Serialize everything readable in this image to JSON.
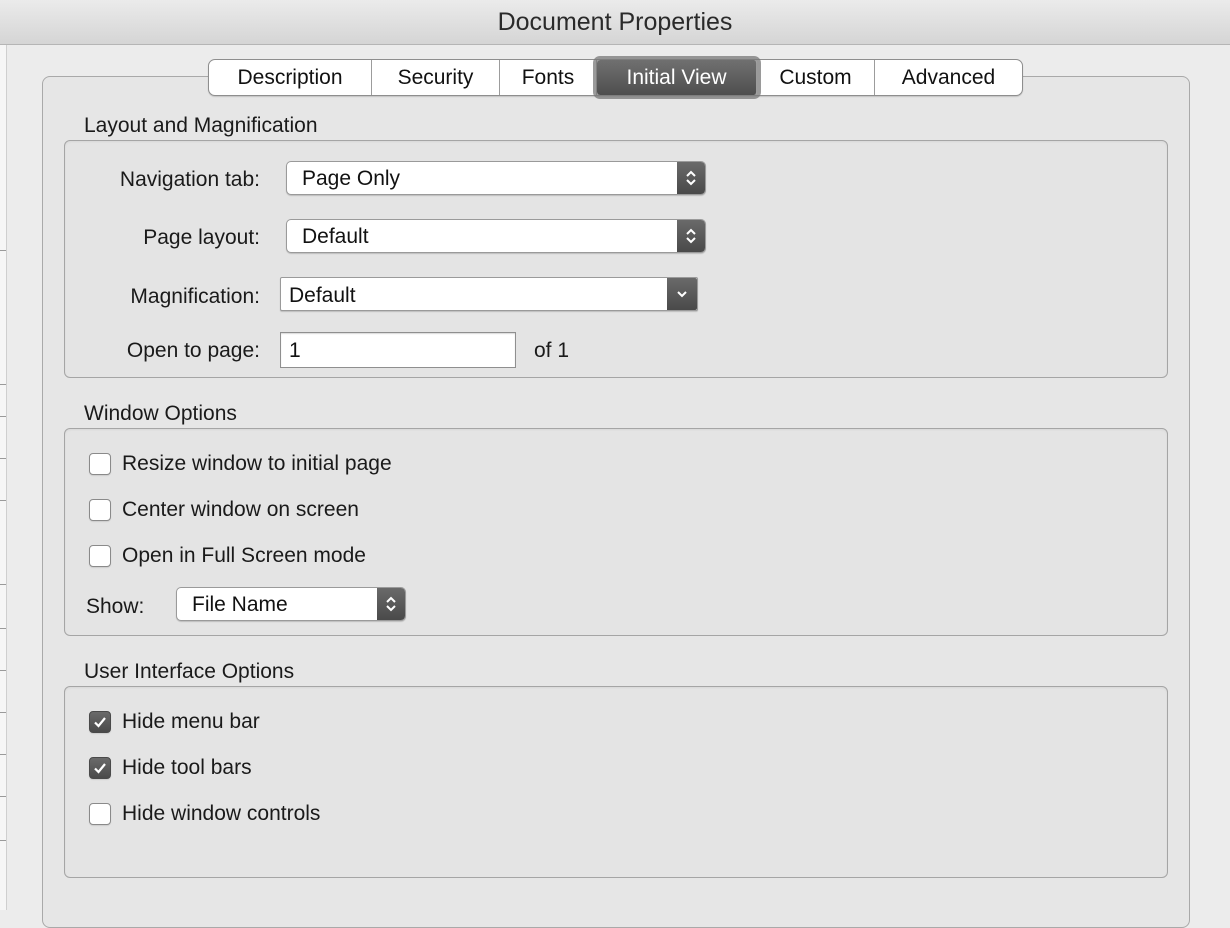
{
  "window": {
    "title": "Document Properties"
  },
  "tabs": [
    {
      "label": "Description",
      "active": false
    },
    {
      "label": "Security",
      "active": false
    },
    {
      "label": "Fonts",
      "active": false
    },
    {
      "label": "Initial View",
      "active": true
    },
    {
      "label": "Custom",
      "active": false
    },
    {
      "label": "Advanced",
      "active": false
    }
  ],
  "layout_magnification": {
    "heading": "Layout and Magnification",
    "navigation_tab": {
      "label": "Navigation tab:",
      "value": "Page Only"
    },
    "page_layout": {
      "label": "Page layout:",
      "value": "Default"
    },
    "magnification": {
      "label": "Magnification:",
      "value": "Default"
    },
    "open_to_page": {
      "label": "Open to page:",
      "value": "1",
      "of_text": "of 1"
    }
  },
  "window_options": {
    "heading": "Window Options",
    "resize": {
      "label": "Resize window to initial page",
      "checked": false
    },
    "center": {
      "label": "Center window on screen",
      "checked": false
    },
    "full_screen": {
      "label": "Open in Full Screen mode",
      "checked": false
    },
    "show": {
      "label": "Show:",
      "value": "File Name"
    }
  },
  "ui_options": {
    "heading": "User Interface Options",
    "hide_menu_bar": {
      "label": "Hide menu bar",
      "checked": true
    },
    "hide_tool_bars": {
      "label": "Hide tool bars",
      "checked": true
    },
    "hide_window_controls": {
      "label": "Hide window controls",
      "checked": false
    }
  },
  "icons": {
    "stepper": "up-down-chevron-icon",
    "dropdown": "chevron-down-icon",
    "checkmark": "checkmark-icon"
  }
}
